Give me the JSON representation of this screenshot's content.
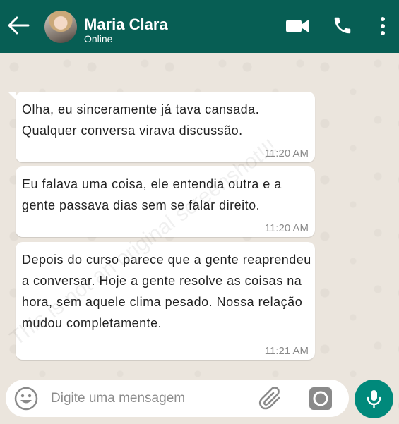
{
  "header": {
    "contact_name": "Maria Clara",
    "status": "Online",
    "back_icon": "arrow-left-icon",
    "video_icon": "video-camera-icon",
    "phone_icon": "phone-icon",
    "menu_icon": "more-vertical-icon",
    "bg_color": "#075e54"
  },
  "messages": [
    {
      "text": "Olha, eu sinceramente já tava cansada. Qualquer conversa virava discussão.",
      "time": "11:20 AM"
    },
    {
      "text": "Eu falava uma coisa, ele entendia outra e a gente passava dias sem se falar direito.",
      "time": "11:20 AM"
    },
    {
      "text": "Depois do curso parece que a gente reaprendeu a conversar. Hoje a gente resolve as coisas na hora, sem aquele clima pesado. Nossa relação mudou completamente.",
      "time": "11:21 AM"
    }
  ],
  "watermark": "This is not an original screenshot!!!",
  "composer": {
    "placeholder": "Digite uma mensagem",
    "emoji_icon": "emoji-icon",
    "attach_icon": "paperclip-icon",
    "camera_icon": "camera-icon",
    "mic_icon": "microphone-icon",
    "accent_color": "#00897b"
  }
}
